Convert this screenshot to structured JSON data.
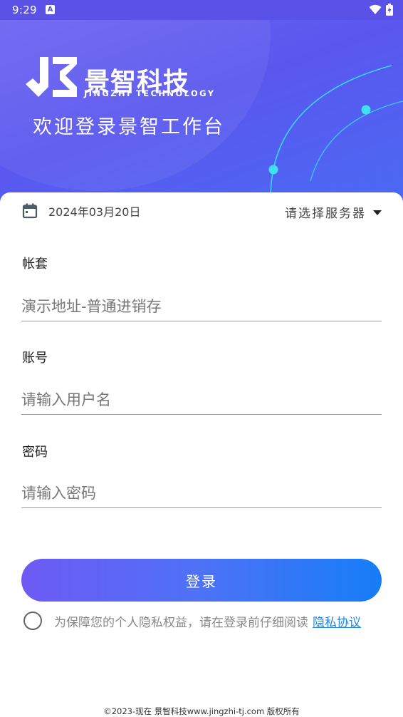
{
  "status_bar": {
    "time": "9:29",
    "notification_icon": "A"
  },
  "header": {
    "brand_name": "景智科技",
    "brand_sub": "JINGZHI TECHNOLOGY",
    "welcome": "欢迎登录景智工作台"
  },
  "date_row": {
    "date": "2024年03月20日"
  },
  "server": {
    "label": "请选择服务器"
  },
  "fields": {
    "account_set": {
      "label": "帐套",
      "placeholder": "演示地址-普通进销存"
    },
    "username": {
      "label": "账号",
      "placeholder": "请输入用户名"
    },
    "password": {
      "label": "密码",
      "placeholder": "请输入密码"
    }
  },
  "login_button": "登录",
  "privacy": {
    "text": "为保障您的个人隐私权益，请在登录前仔细阅读",
    "link": "隐私协议"
  },
  "footer": "©2023-现在 景智科技www.jingzhi-tj.com 版权所有",
  "colors": {
    "header_start": "#6b63f2",
    "header_end": "#4a6af3",
    "button_start": "#6e5af4",
    "button_end": "#167df7",
    "link": "#1f88e8",
    "accent_dot": "#3fe0f0"
  }
}
